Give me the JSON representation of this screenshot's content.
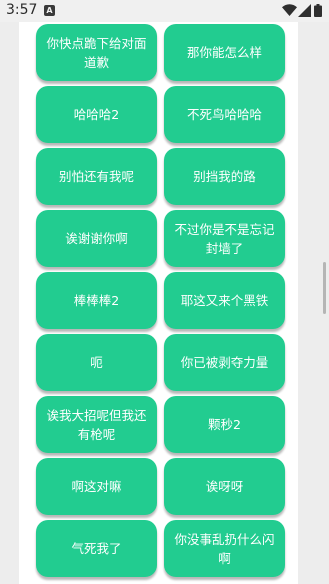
{
  "status_bar": {
    "time": "3:57",
    "notification_icon": "A"
  },
  "phrases": [
    "你快点跪下给对面道歉",
    "那你能怎么样",
    "哈哈哈2",
    "不死鸟哈哈哈",
    "别怕还有我呢",
    "别挡我的路",
    "诶谢谢你啊",
    "不过你是不是忘记封墙了",
    "棒棒棒2",
    "耶这又来个黑铁",
    "呃",
    "你已被剥夺力量",
    "诶我大招呢但我还有枪呢",
    "颗秒2",
    "啊这对嘛",
    "诶呀呀",
    "气死我了",
    "你没事乱扔什么闪啊"
  ],
  "colors": {
    "button_background": "#22cc90",
    "button_text": "#ffffff",
    "page_background": "#ededed",
    "card_background": "#ffffff"
  },
  "icons": {
    "status_icons": [
      "notification-a-icon",
      "wifi-icon",
      "cellular-signal-icon",
      "battery-icon"
    ]
  }
}
